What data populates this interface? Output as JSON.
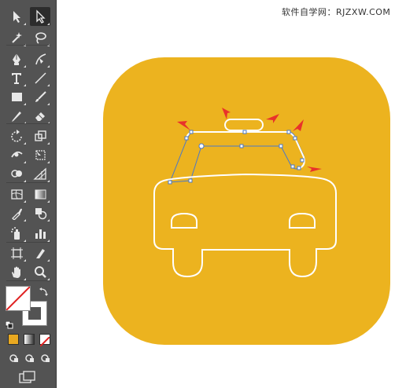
{
  "watermark": {
    "text": "软件自学网：RJZXW.COM"
  },
  "toolbar": {
    "rows": [
      {
        "left": "selection-tool-icon",
        "right": "direct-selection-tool-icon"
      },
      {
        "left": "magic-wand-tool-icon",
        "right": "lasso-tool-icon"
      },
      {
        "left": "pen-tool-icon",
        "right": "curvature-tool-icon"
      },
      {
        "left": "type-tool-icon",
        "right": "line-segment-tool-icon"
      },
      {
        "left": "rectangle-tool-icon",
        "right": "paintbrush-tool-icon"
      },
      {
        "left": "pencil-tool-icon",
        "right": "eraser-tool-icon"
      },
      {
        "left": "rotate-tool-icon",
        "right": "scale-tool-icon"
      },
      {
        "left": "width-tool-icon",
        "right": "free-transform-tool-icon"
      },
      {
        "left": "shape-builder-tool-icon",
        "right": "perspective-grid-tool-icon"
      },
      {
        "left": "mesh-tool-icon",
        "right": "gradient-tool-icon"
      },
      {
        "left": "eyedropper-tool-icon",
        "right": "blend-tool-icon"
      },
      {
        "left": "symbol-sprayer-tool-icon",
        "right": "column-graph-tool-icon"
      },
      {
        "left": "artboard-tool-icon",
        "right": "slice-tool-icon"
      },
      {
        "left": "hand-tool-icon",
        "right": "zoom-tool-icon"
      }
    ],
    "selected_tool": "direct-selection-tool-icon"
  },
  "colors": {
    "toolbar_bg": "#535353",
    "icon_fill": "#e8e8e8",
    "icon_background": "#ecb31f",
    "stroke_white": "#ffffff",
    "selection_blue": "#4a78c8",
    "arrow_red": "#e8322b",
    "none_red": "#e02020",
    "color_mode": "#e8a820"
  }
}
